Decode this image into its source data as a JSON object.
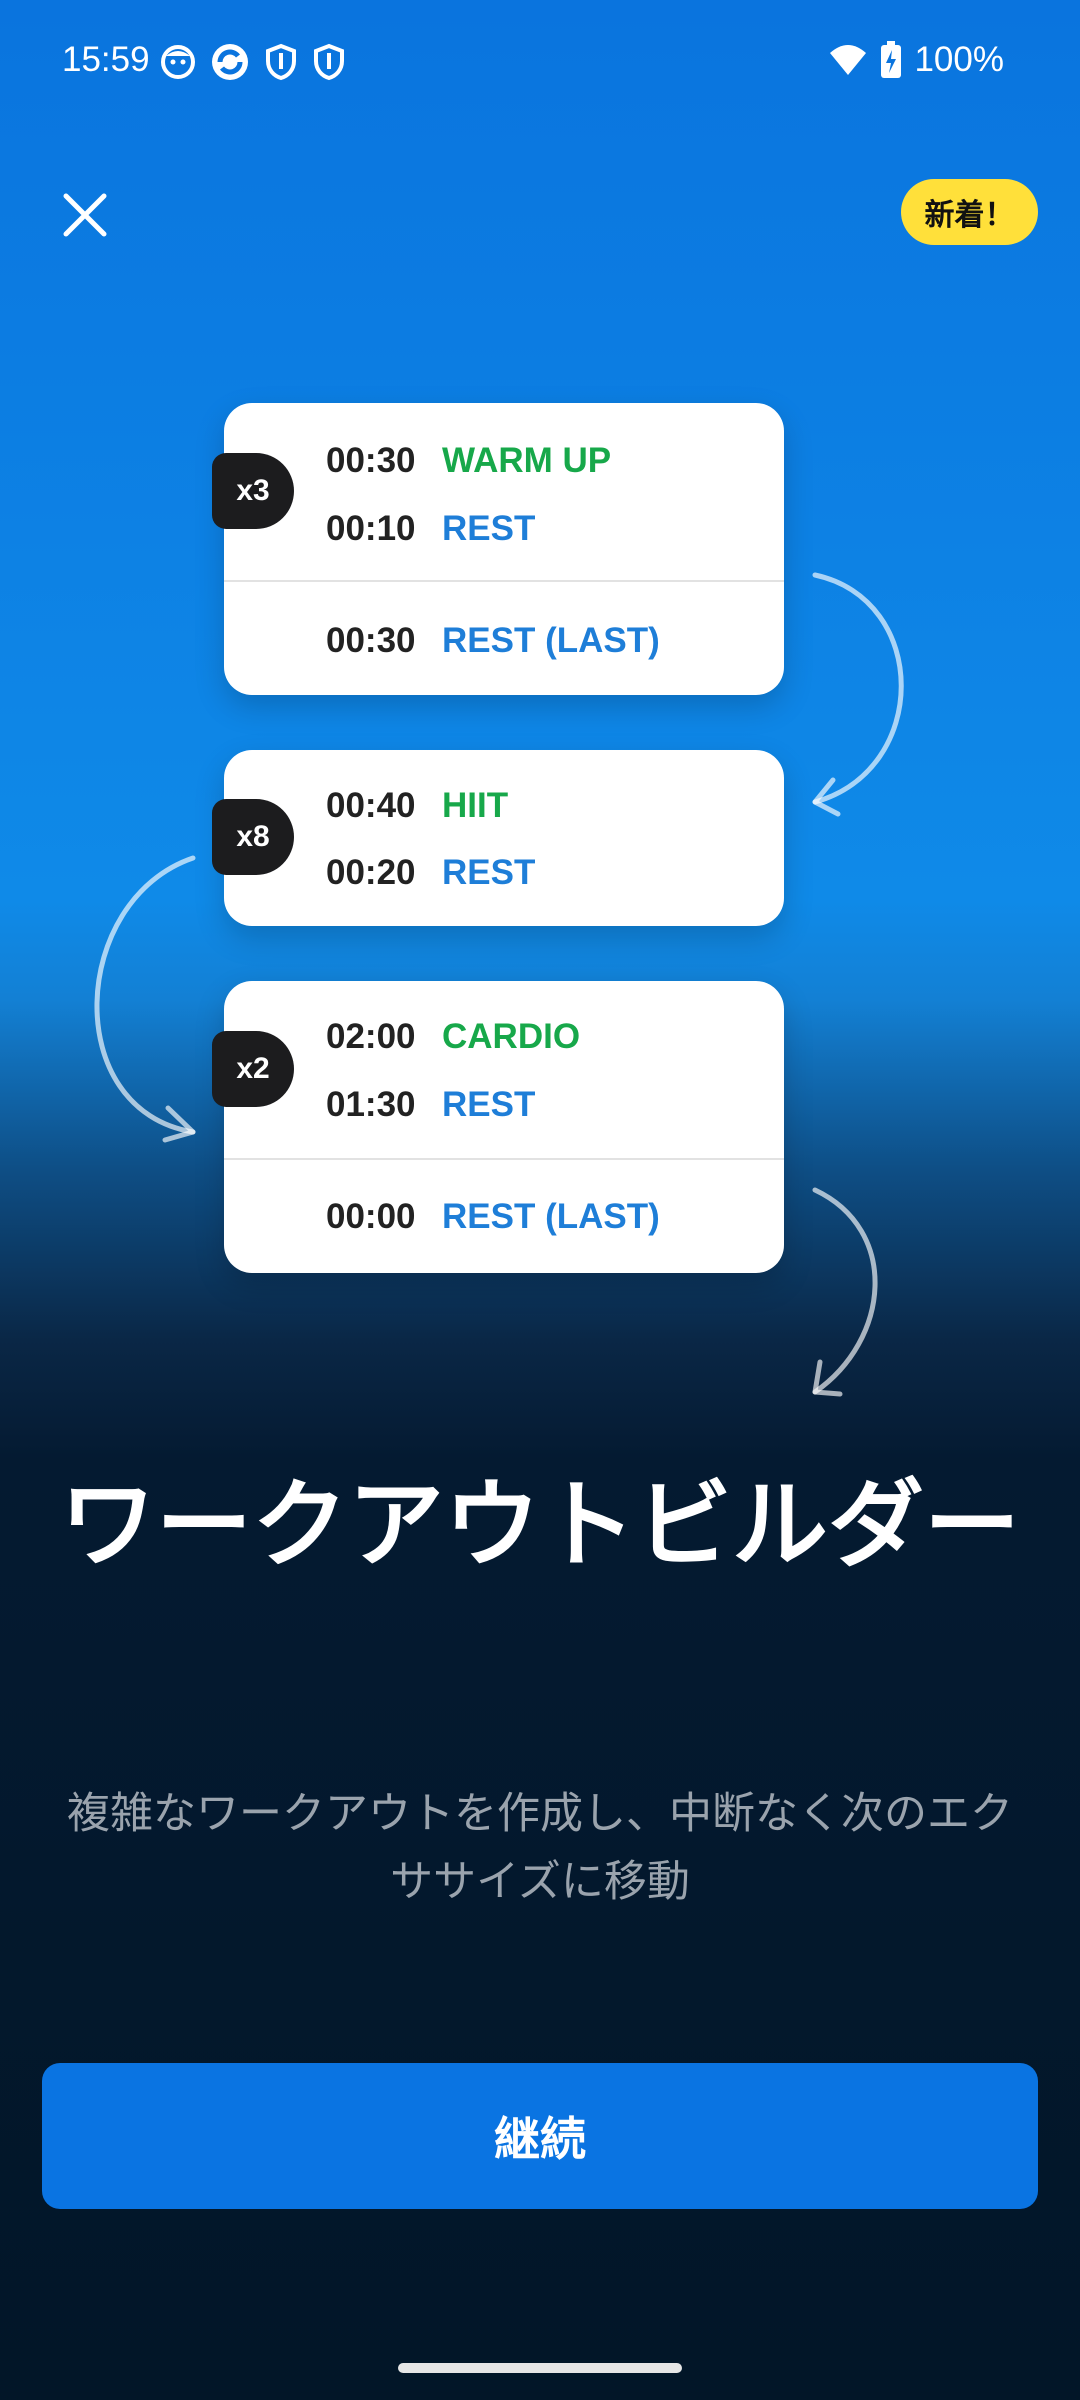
{
  "status_bar": {
    "time": "15:59",
    "battery": "100%",
    "left_icons": [
      "face-app-icon",
      "sync-app-icon",
      "shield-icon",
      "shield-icon"
    ],
    "right_icons": [
      "wifi-icon",
      "battery-charging-icon"
    ]
  },
  "header": {
    "close_icon": "close-icon",
    "new_badge": "新着！"
  },
  "workout_cards": [
    {
      "reps": "x3",
      "intervals": [
        {
          "time": "00:30",
          "label": "WARM UP",
          "color": "#17A84A"
        },
        {
          "time": "00:10",
          "label": "REST",
          "color": "#1E7ED8"
        }
      ],
      "last": {
        "time": "00:30",
        "label": "REST (LAST)",
        "color": "#1E7ED8"
      }
    },
    {
      "reps": "x8",
      "intervals": [
        {
          "time": "00:40",
          "label": "HIIT",
          "color": "#17A84A"
        },
        {
          "time": "00:20",
          "label": "REST",
          "color": "#1E7ED8"
        }
      ]
    },
    {
      "reps": "x2",
      "intervals": [
        {
          "time": "02:00",
          "label": "CARDIO",
          "color": "#17A84A"
        },
        {
          "time": "01:30",
          "label": "REST",
          "color": "#1E7ED8"
        }
      ],
      "last": {
        "time": "00:00",
        "label": "REST (LAST)",
        "color": "#1E7ED8"
      }
    }
  ],
  "title": "ワークアウトビルダー",
  "subtitle": "複雑なワークアウトを作成し、中断なく次のエクササイズに移動",
  "continue_button": "継続",
  "colors": {
    "accent": "#0A74E2",
    "badge": "#FFE03A",
    "work_label": "#17A84A",
    "rest_label": "#1E7ED8"
  }
}
